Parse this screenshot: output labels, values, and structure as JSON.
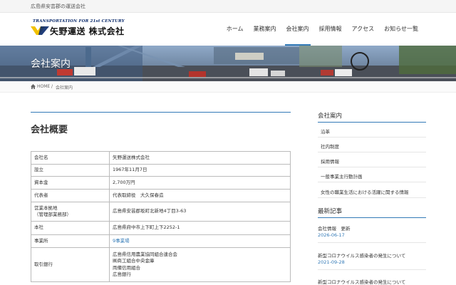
{
  "topbar": {
    "tagline": "広島県安芸郡の運送会社"
  },
  "logo": {
    "tag": "TRANSPORTATION FOR 21st CENTURY",
    "name": "矢野運送 株式会社"
  },
  "nav": {
    "items": [
      "ホーム",
      "業務案内",
      "会社案内",
      "採用情報",
      "アクセス",
      "お知らせ一覧"
    ],
    "active": "会社案内"
  },
  "hero": {
    "title": "会社案内"
  },
  "breadcrumb": {
    "home": "HOME",
    "separator": "/",
    "current": "会社案内"
  },
  "main": {
    "title": "会社概要",
    "rows": [
      {
        "key": [
          "会社名"
        ],
        "value": [
          "矢野運送株式会社"
        ]
      },
      {
        "key": [
          "設立"
        ],
        "value": [
          "1967年11月7日"
        ]
      },
      {
        "key": [
          "資本金"
        ],
        "value": [
          "2,700万円"
        ]
      },
      {
        "key": [
          "代表者"
        ],
        "value": [
          "代表取締役　大久保春造"
        ]
      },
      {
        "key": [
          "営業本拠地",
          "（管理部業務部）"
        ],
        "value": [
          "広島県安芸郡坂町北新地4丁目3-63"
        ]
      },
      {
        "key": [
          "本社"
        ],
        "value": [
          "広島県府中市上下町上下2252-1"
        ]
      },
      {
        "key": [
          "事業所"
        ],
        "value": [
          "9事業場"
        ],
        "value_is_link": true
      },
      {
        "key": [
          "取引銀行"
        ],
        "value": [
          "広島県信用農業協同組合連合会",
          "㈱商工組合中央金庫",
          "両備信用組合",
          "広島銀行"
        ]
      }
    ]
  },
  "sidebar": {
    "section1_title": "会社案内",
    "links": [
      "沿革",
      "社内制度",
      "採用情報",
      "一般事業主行動計画",
      "女性の職業生活における活躍に関する情報"
    ],
    "section2_title": "最新記事",
    "posts": [
      {
        "title": "会社情報　更新",
        "date": "2026-06-17"
      },
      {
        "title": "新型コロナウイルス感染者の発生について",
        "date": "2021-09-28"
      },
      {
        "title": "新型コロナウイルス感染者の発生について",
        "date": ""
      }
    ]
  },
  "colors": {
    "accent": "#337ab7",
    "logo_yellow": "#f2c100",
    "logo_navy": "#0a2a6b"
  }
}
